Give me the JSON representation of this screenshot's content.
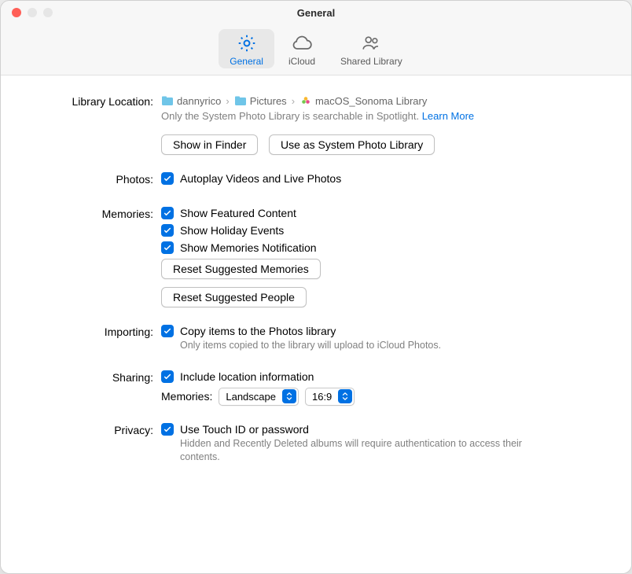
{
  "window_title": "General",
  "toolbar": {
    "items": [
      {
        "label": "General",
        "selected": true
      },
      {
        "label": "iCloud",
        "selected": false
      },
      {
        "label": "Shared Library",
        "selected": false
      }
    ]
  },
  "library_location": {
    "label": "Library Location:",
    "path": [
      "dannyrico",
      "Pictures",
      "macOS_Sonoma Library"
    ],
    "note": "Only the System Photo Library is searchable in Spotlight.",
    "learn_more": "Learn More",
    "show_in_finder": "Show in Finder",
    "use_as_system": "Use as System Photo Library"
  },
  "photos": {
    "label": "Photos:",
    "autoplay": "Autoplay Videos and Live Photos"
  },
  "memories": {
    "label": "Memories:",
    "featured": "Show Featured Content",
    "holiday": "Show Holiday Events",
    "notification": "Show Memories Notification",
    "reset_memories": "Reset Suggested Memories",
    "reset_people": "Reset Suggested People"
  },
  "importing": {
    "label": "Importing:",
    "copy": "Copy items to the Photos library",
    "desc": "Only items copied to the library will upload to iCloud Photos."
  },
  "sharing": {
    "label": "Sharing:",
    "include_location": "Include location information",
    "memories_label": "Memories:",
    "orientation": "Landscape",
    "aspect": "16:9"
  },
  "privacy": {
    "label": "Privacy:",
    "touchid": "Use Touch ID or password",
    "desc": "Hidden and Recently Deleted albums will require authentication to access their contents."
  }
}
